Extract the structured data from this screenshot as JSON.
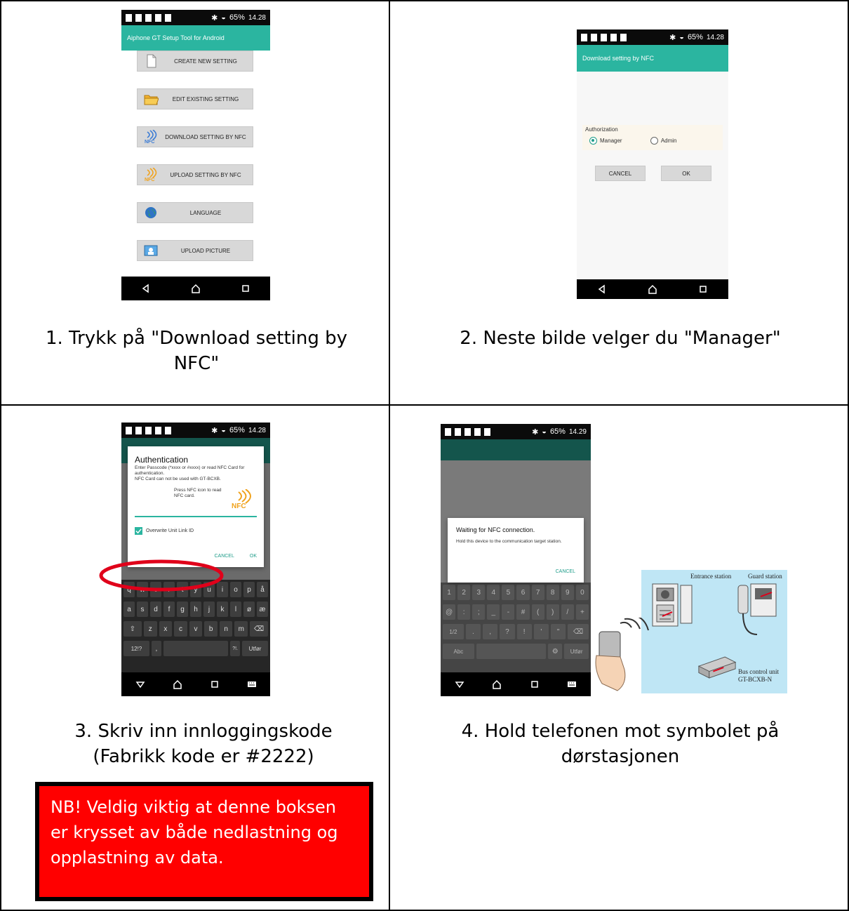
{
  "cells": {
    "step1": {
      "caption_line1": "1.   Trykk på \"Download setting by",
      "caption_line2": "NFC\"",
      "phone": {
        "time": "14.28",
        "battery": "65%",
        "app_title": "Aiphone GT Setup Tool for Android",
        "buttons": [
          {
            "label": "CREATE NEW SETTING",
            "icon": "document-icon"
          },
          {
            "label": "EDIT EXISTING SETTING",
            "icon": "folder-icon"
          },
          {
            "label": "DOWNLOAD SETTING BY NFC",
            "icon": "nfc-download-icon"
          },
          {
            "label": "UPLOAD SETTING BY NFC",
            "icon": "nfc-upload-icon"
          },
          {
            "label": "LANGUAGE",
            "icon": "globe-icon"
          },
          {
            "label": "UPLOAD PICTURE",
            "icon": "picture-icon"
          }
        ]
      }
    },
    "step2": {
      "caption": "2.   Neste bilde velger du \"Manager\"",
      "phone": {
        "time": "14.28",
        "battery": "65%",
        "app_title": "Download setting by NFC",
        "auth_label": "Authorization",
        "option_manager": "Manager",
        "option_admin": "Admin",
        "selected": "Manager",
        "cancel": "CANCEL",
        "ok": "OK"
      }
    },
    "step3": {
      "caption_line1": "3.   Skriv inn innloggingskode",
      "caption_line2": "(Fabrikk kode er #2222)",
      "phone": {
        "time": "14.28",
        "battery": "65%",
        "dialog_title": "Authentication",
        "dialog_text": "Enter Passcode (*xxxx or #xxxx) or read NFC Card for authentication.\nNFC Card can not be used with GT-BCXB.",
        "nfc_hint": "Press NFC icon to read NFC card.",
        "checkbox_label": "Overwrite Unit Link ID",
        "checkbox_checked": true,
        "cancel": "CANCEL",
        "ok": "OK",
        "keyboard_rows": [
          [
            "q",
            "w",
            "e",
            "r",
            "t",
            "y",
            "u",
            "i",
            "o",
            "p",
            "å"
          ],
          [
            "a",
            "s",
            "d",
            "f",
            "g",
            "h",
            "j",
            "k",
            "l",
            "ø",
            "æ"
          ],
          [
            "⇧",
            "z",
            "x",
            "c",
            "v",
            "b",
            "n",
            "m",
            "⌫"
          ],
          [
            "12!?",
            ",",
            "",
            "?!.",
            "Utfør"
          ]
        ]
      },
      "note": "NB! Veldig viktig at denne boksen er krysset av både nedlastning og opplastning av data."
    },
    "step4": {
      "caption_line1": "4.   Hold telefonen mot symbolet på",
      "caption_line2": "dørstasjonen",
      "phone": {
        "time": "14.29",
        "battery": "65%",
        "dialog_title": "Waiting for NFC connection.",
        "dialog_text": "Hold this device to the communication target station.",
        "cancel": "CANCEL",
        "keyboard_rows": [
          [
            "1",
            "2",
            "3",
            "4",
            "5",
            "6",
            "7",
            "8",
            "9",
            "0"
          ],
          [
            "@",
            ":",
            ";",
            "_",
            "-",
            "#",
            "(",
            ")",
            "/",
            "+"
          ],
          [
            "1/2",
            ".",
            ",",
            "?",
            "!",
            "'",
            "\"",
            "⌫"
          ],
          [
            "Abc",
            "",
            "⚙",
            "Utfør"
          ]
        ]
      },
      "illustration": {
        "entrance_station": "Entrance station",
        "guard_station": "Guard station",
        "bus_control_unit": "Bus control unit",
        "model": "GT-BCXB-N"
      }
    }
  },
  "colors": {
    "teal": "#2bb5a0",
    "red_highlight": "#e0001a",
    "note_bg": "#ff0000",
    "illustration_bg": "#bfe6f5"
  }
}
